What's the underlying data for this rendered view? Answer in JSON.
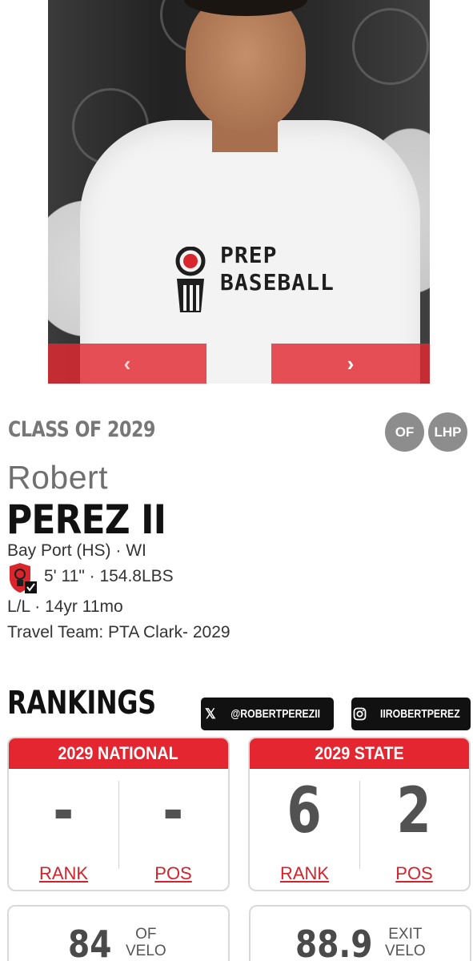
{
  "hero": {
    "shirt_brand_line1": "PREP",
    "shirt_brand_line2": "BASEBALL",
    "prev_icon": "chevron-left-icon",
    "next_icon": "chevron-right-icon",
    "prev_glyph": "‹",
    "next_glyph": "›"
  },
  "player": {
    "class_of": "CLASS OF 2029",
    "positions": [
      "OF",
      "LHP"
    ],
    "first_name": "Robert",
    "last_name": "PEREZ II",
    "school_state": "Bay Port (HS) · WI",
    "height_weight": "5' 11\" · 154.8LBS",
    "bats_age": "L/L · 14yr 11mo",
    "travel_team": "Travel Team: PTA Clark- 2029"
  },
  "rankings": {
    "title": "RANKINGS",
    "social": {
      "x_handle": "@ROBERTPEREZII",
      "instagram_handle": "IIROBERTPEREZ"
    },
    "national": {
      "header": "2029 NATIONAL",
      "rank_value": "-",
      "pos_value": "-",
      "rank_label": "RANK",
      "pos_label": "POS"
    },
    "state": {
      "header": "2029 STATE",
      "rank_value": "6",
      "pos_value": "2",
      "rank_label": "RANK",
      "pos_label": "POS"
    }
  },
  "stats": {
    "of_velo": {
      "value": "84",
      "label_line1": "OF",
      "label_line2": "VELO"
    },
    "exit_velo": {
      "value": "88.9",
      "label_line1": "EXIT",
      "label_line2": "VELO"
    }
  },
  "colors": {
    "accent_red": "#e3262f",
    "badge_gray": "#8d8d8d"
  }
}
